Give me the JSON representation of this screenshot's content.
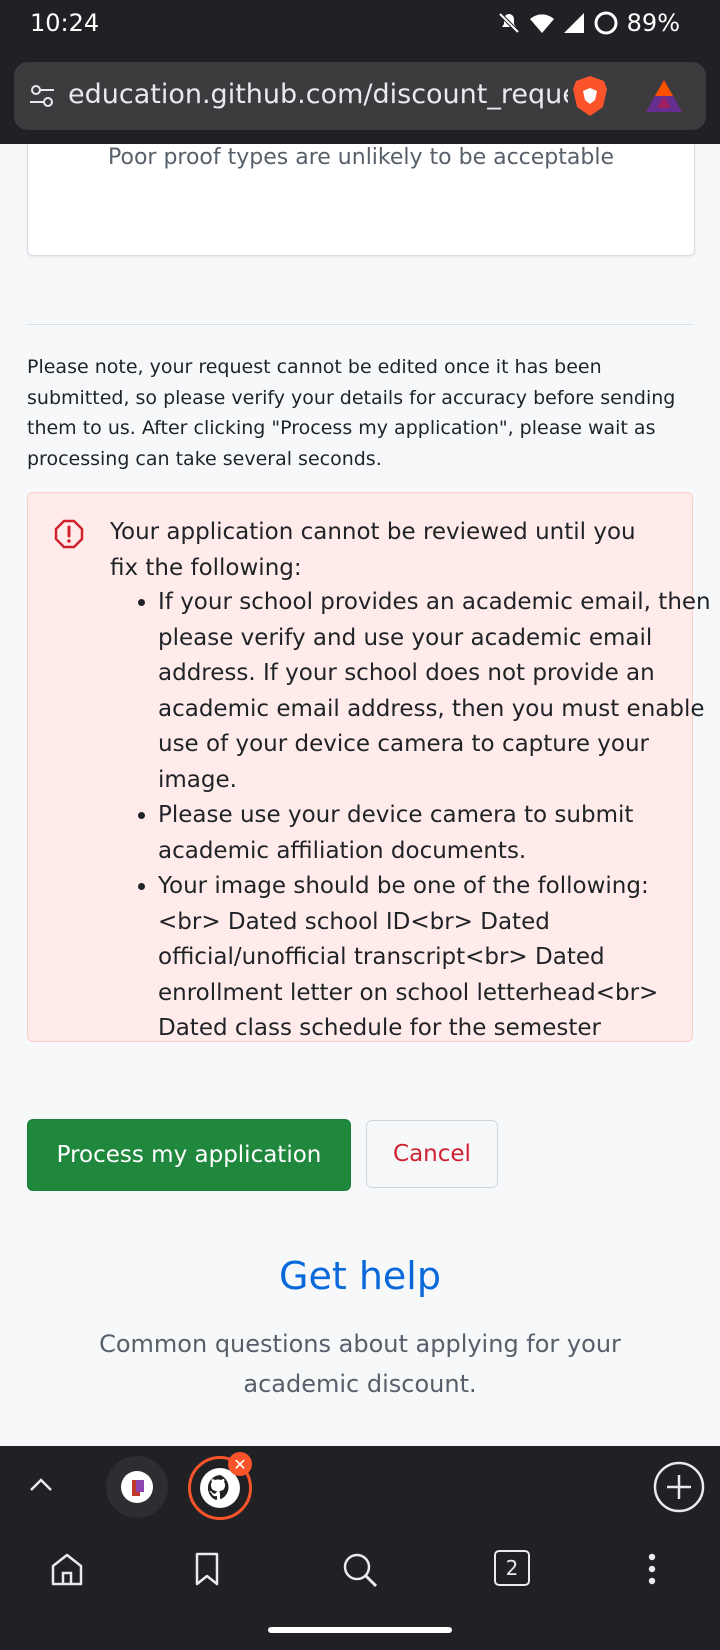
{
  "status": {
    "time": "10:24",
    "battery": "89%"
  },
  "browser": {
    "url": "education.github.com/discount_reques"
  },
  "card": {
    "proof_prefix": "Poor",
    "proof_rest": " proof types are unlikely to be acceptable"
  },
  "note": "Please note, your request cannot be edited once it has been submitted, so please verify your details for accuracy before sending them to us. After clicking \"Process my application\", please wait as processing can take several seconds.",
  "error": {
    "title": "Your application cannot be reviewed until you fix the following:",
    "items": [
      "If your school provides an academic email, then please verify and use your academic email address. If your school does not provide an academic email address, then you must enable use of your device camera to capture your image.",
      "Please use your device camera to submit academic affiliation documents.",
      "Your image should be one of the following: <br> Dated school ID<br> Dated official/unofficial transcript<br> Dated enrollment letter on school letterhead<br> Dated class schedule for the semester"
    ]
  },
  "buttons": {
    "process": "Process my application",
    "cancel": "Cancel"
  },
  "help": {
    "title": "Get help",
    "subtitle": "Common questions about applying for your academic discount."
  },
  "tabs": {
    "count": "2"
  },
  "icons": [
    "mute-icon",
    "wifi-icon",
    "signal-icon",
    "battery-icon",
    "tune-icon",
    "brave-shield-icon",
    "bat-rewards-icon",
    "alert-icon",
    "chevron-up-icon",
    "github-icon",
    "close-icon",
    "plus-icon",
    "home-icon",
    "bookmark-icon",
    "search-icon",
    "tabs-icon",
    "more-icon"
  ],
  "colors": {
    "primary_button": "#1f883d",
    "danger": "#cf222e",
    "link": "#0969da",
    "error_bg": "#ffebe9"
  }
}
